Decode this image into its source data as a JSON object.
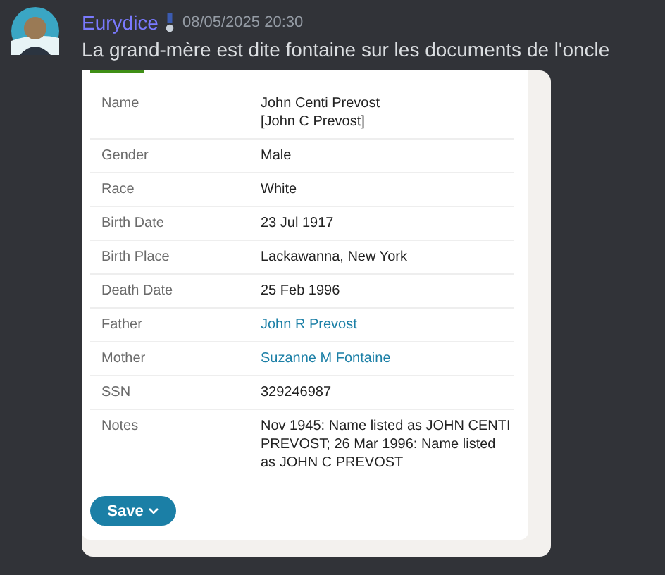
{
  "message": {
    "author": "Eurydice",
    "timestamp": "08/05/2025 20:30",
    "text": "La grand-mère est dite fontaine sur les documents de l'oncle"
  },
  "record": {
    "fields": [
      {
        "label": "Name",
        "value": "John Centi Prevost\n[John C Prevost]",
        "kind": "text"
      },
      {
        "label": "Gender",
        "value": "Male",
        "kind": "text"
      },
      {
        "label": "Race",
        "value": "White",
        "kind": "text"
      },
      {
        "label": "Birth Date",
        "value": "23 Jul 1917",
        "kind": "text"
      },
      {
        "label": "Birth Place",
        "value": "Lackawanna, New York",
        "kind": "text"
      },
      {
        "label": "Death Date",
        "value": "25 Feb 1996",
        "kind": "text"
      },
      {
        "label": "Father",
        "value": "John R Prevost",
        "kind": "link"
      },
      {
        "label": "Mother",
        "value": "Suzanne M Fontaine",
        "kind": "link"
      },
      {
        "label": "SSN",
        "value": "329246987",
        "kind": "text"
      },
      {
        "label": "Notes",
        "value": "Nov 1945: Name listed as JOHN CENTI PREVOST; 26 Mar 1996: Name listed as JOHN C PREVOST",
        "kind": "text"
      }
    ],
    "save_button": "Save"
  }
}
